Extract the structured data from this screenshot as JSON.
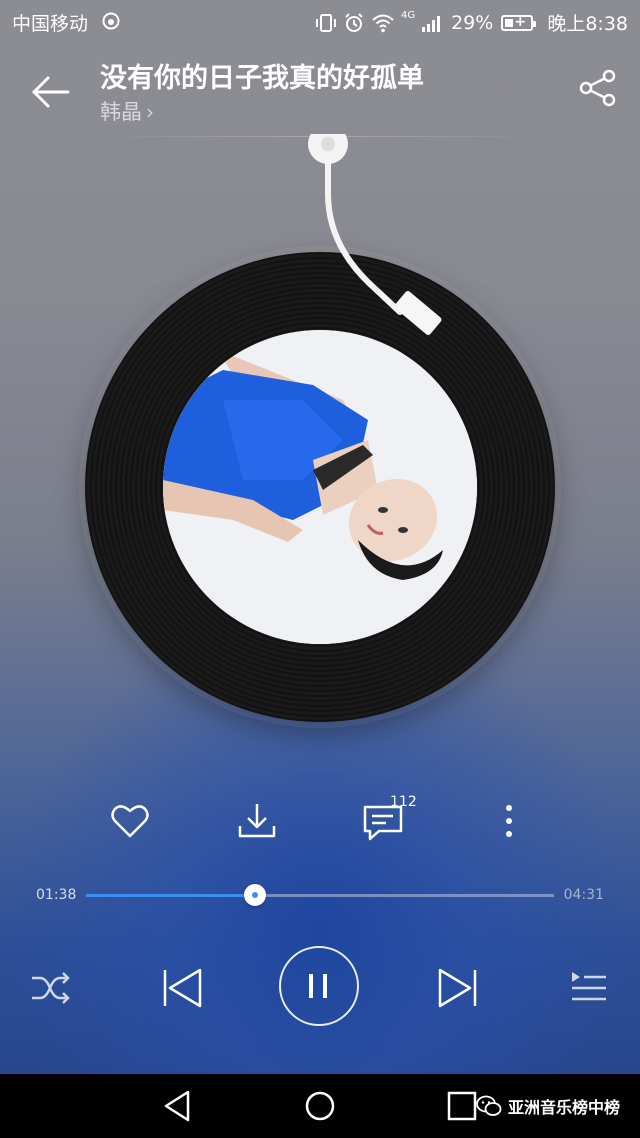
{
  "status_bar": {
    "carrier": "中国移动",
    "network": "4G",
    "battery_percent": "29%",
    "time": "晚上8:38"
  },
  "song": {
    "title": "没有你的日子我真的好孤单",
    "artist": "韩晶"
  },
  "actions": {
    "comment_count": "112"
  },
  "progress": {
    "current_time": "01:38",
    "total_time": "04:31",
    "fraction": 0.362
  },
  "watermark": {
    "text": "亚洲音乐榜中榜"
  },
  "colors": {
    "accent": "#3a8ff0",
    "nav_bar": "#000000"
  },
  "icons": {
    "back": "arrow-left-icon",
    "share": "share-icon",
    "like": "heart-icon",
    "download": "download-icon",
    "comment": "comment-icon",
    "more": "more-vertical-icon",
    "shuffle": "shuffle-icon",
    "previous": "skip-previous-icon",
    "pause": "pause-icon",
    "next": "skip-next-icon",
    "playlist": "playlist-icon"
  }
}
